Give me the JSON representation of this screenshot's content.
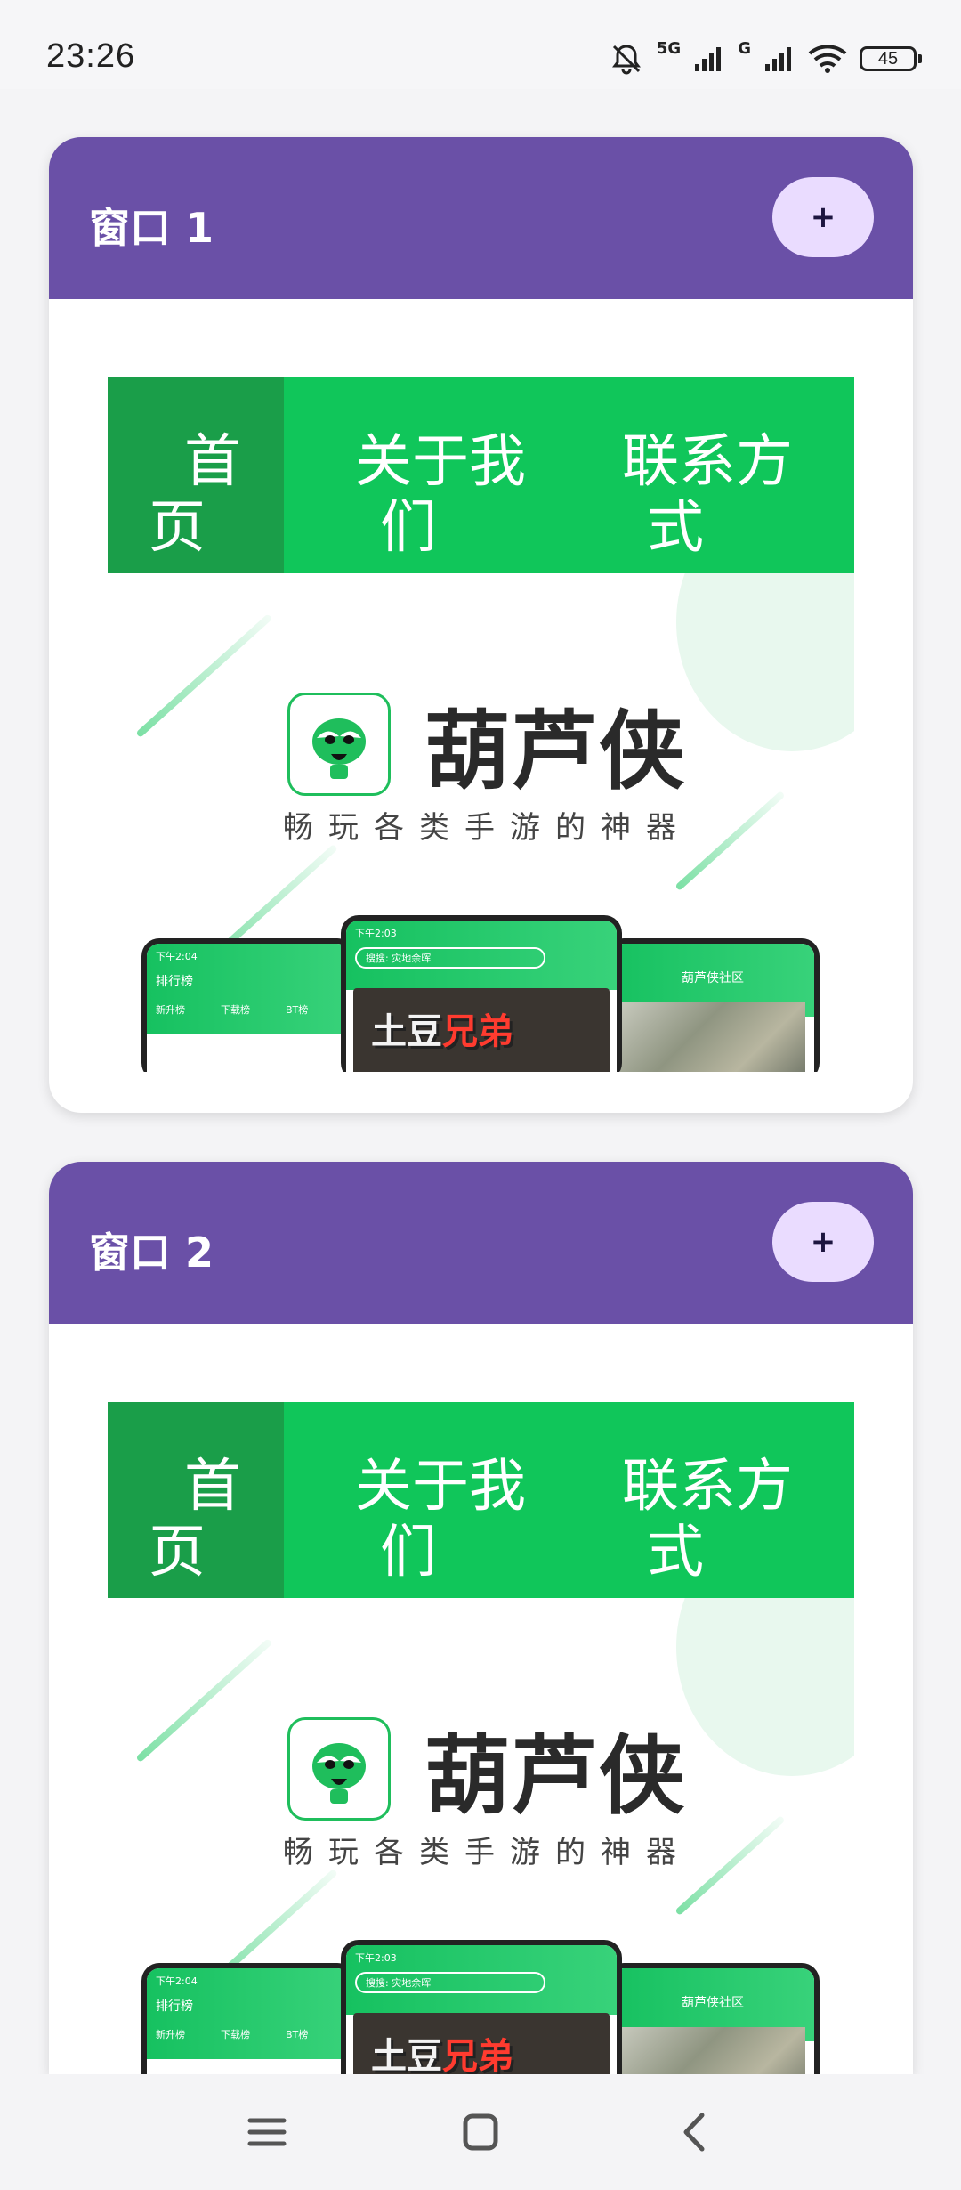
{
  "status_bar": {
    "time": "23:26",
    "net1": "5G",
    "net2": "G",
    "battery": "45",
    "icons": [
      "mute-bell-icon",
      "signal-icon",
      "signal-icon",
      "wifi-icon",
      "battery-icon"
    ]
  },
  "cards": [
    {
      "title": "窗口 1",
      "add_label": "+",
      "site": {
        "nav": {
          "home": [
            "首",
            "页"
          ],
          "about": [
            "关于我",
            "们"
          ],
          "contact": [
            "联系方",
            "式"
          ]
        },
        "brand": "葫芦侠",
        "slogan": "畅玩各类手游的神器",
        "phone_left": {
          "status": "下午2:04",
          "title": "排行榜",
          "tabs": [
            "新升榜",
            "下载榜",
            "BT榜"
          ]
        },
        "phone_center": {
          "status": "下午2:03",
          "search": "搜搜: 灾地余晖",
          "game_a": "土豆",
          "game_b": "兄弟"
        },
        "phone_right": {
          "title": "葫芦侠社区"
        }
      }
    },
    {
      "title": "窗口 2",
      "add_label": "+",
      "site": {
        "nav": {
          "home": [
            "首",
            "页"
          ],
          "about": [
            "关于我",
            "们"
          ],
          "contact": [
            "联系方",
            "式"
          ]
        },
        "brand": "葫芦侠",
        "slogan": "畅玩各类手游的神器",
        "phone_left": {
          "status": "下午2:04",
          "title": "排行榜",
          "tabs": [
            "新升榜",
            "下载榜",
            "BT榜"
          ]
        },
        "phone_center": {
          "status": "下午2:03",
          "search": "搜搜: 灾地余晖",
          "game_a": "土豆",
          "game_b": "兄弟"
        },
        "phone_right": {
          "title": "葫芦侠社区"
        }
      }
    }
  ],
  "colors": {
    "header": "#6a50a7",
    "add_button": "#eadcff",
    "nav_green": "#10c65a",
    "nav_active": "#1a9e49"
  },
  "system_nav": [
    "menu-icon",
    "home-icon",
    "back-icon"
  ]
}
